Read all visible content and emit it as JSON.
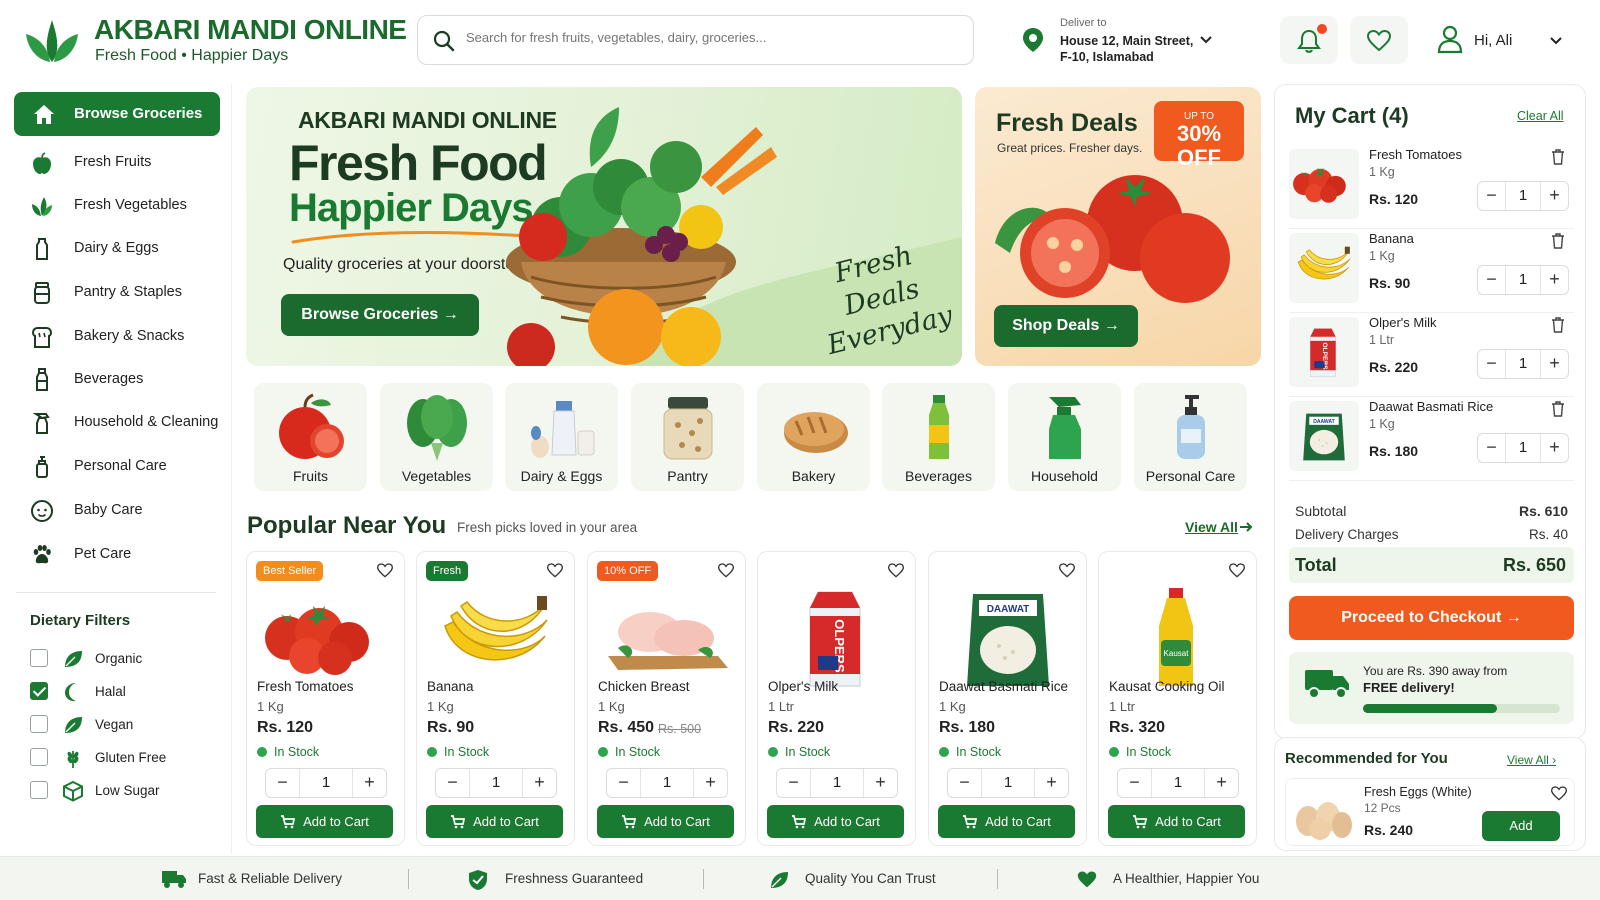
{
  "header": {
    "brand": "AKBARI MANDI ONLINE",
    "tagline": "Fresh Food • Happier Days",
    "search_placeholder": "Search for fresh fruits, vegetables, dairy, groceries...",
    "deliver_label": "Deliver to",
    "deliver_address": "House 12, Main Street, F-10, Islamabad",
    "greeting": "Hi, Ali",
    "icons": [
      "leaf-logo",
      "search",
      "location-pin",
      "chevron-down",
      "bell",
      "heart",
      "user"
    ],
    "notification_dot": true
  },
  "sidebar": {
    "active": {
      "label": "Browse Groceries",
      "icon": "home"
    },
    "items": [
      {
        "label": "Fresh Fruits",
        "icon": "apple"
      },
      {
        "label": "Fresh Vegetables",
        "icon": "leaf"
      },
      {
        "label": "Dairy & Eggs",
        "icon": "bottle"
      },
      {
        "label": "Pantry & Staples",
        "icon": "jar"
      },
      {
        "label": "Bakery & Snacks",
        "icon": "bread"
      },
      {
        "label": "Beverages",
        "icon": "drink-bottle"
      },
      {
        "label": "Household & Cleaning",
        "icon": "spray-bottle"
      },
      {
        "label": "Personal Care",
        "icon": "pump-bottle"
      },
      {
        "label": "Baby Care",
        "icon": "baby-face"
      },
      {
        "label": "Pet Care",
        "icon": "paw"
      }
    ],
    "filters_title": "Dietary Filters",
    "filters": [
      {
        "label": "Organic",
        "checked": false,
        "icon": "leaf"
      },
      {
        "label": "Halal",
        "checked": true,
        "icon": "crescent-moon"
      },
      {
        "label": "Vegan",
        "checked": false,
        "icon": "leaf"
      },
      {
        "label": "Gluten Free",
        "checked": false,
        "icon": "wheat"
      },
      {
        "label": "Low Sugar",
        "checked": false,
        "icon": "cube"
      }
    ]
  },
  "hero": {
    "kicker": "AKBARI MANDI ONLINE",
    "title_line1": "Fresh Food",
    "title_line2": "Happier Days",
    "description": "Quality groceries at your doorstep.",
    "button": "Browse Groceries",
    "script_line1": "Fresh",
    "script_line2": "Deals",
    "script_line3": "Everyday"
  },
  "deals": {
    "title": "Fresh Deals",
    "subtitle": "Great prices. Fresher days.",
    "badge_top": "UP TO",
    "badge_value": "30% OFF",
    "button": "Shop Deals"
  },
  "categories": [
    {
      "label": "Fruits",
      "icon": "apple"
    },
    {
      "label": "Vegetables",
      "icon": "leafy-greens"
    },
    {
      "label": "Dairy & Eggs",
      "icon": "milk-eggs"
    },
    {
      "label": "Pantry",
      "icon": "jar"
    },
    {
      "label": "Bakery",
      "icon": "bread"
    },
    {
      "label": "Beverages",
      "icon": "bottle"
    },
    {
      "label": "Household",
      "icon": "spray-bottle"
    },
    {
      "label": "Personal Care",
      "icon": "pump-bottle"
    }
  ],
  "popular": {
    "title": "Popular Near You",
    "subtitle": "Fresh picks loved in your area",
    "view_all": "View All",
    "add_label": "Add to Cart",
    "products": [
      {
        "name": "Fresh Tomatoes",
        "unit": "1 Kg",
        "price": "Rs. 120",
        "old_price": "",
        "stock": "In Stock",
        "qty": "1",
        "badge": "Best Seller",
        "badge_color": "#f28c1c",
        "image": "tomatoes"
      },
      {
        "name": "Banana",
        "unit": "1 Kg",
        "price": "Rs. 90",
        "old_price": "",
        "stock": "In Stock",
        "qty": "1",
        "badge": "Fresh",
        "badge_color": "#1b7a32",
        "image": "bananas"
      },
      {
        "name": "Chicken Breast",
        "unit": "1 Kg",
        "price": "Rs. 450",
        "old_price": "Rs. 500",
        "stock": "In Stock",
        "qty": "1",
        "badge": "10% OFF",
        "badge_color": "#f05a1e",
        "image": "chicken"
      },
      {
        "name": "Olper's Milk",
        "unit": "1 Ltr",
        "price": "Rs. 220",
        "old_price": "",
        "stock": "In Stock",
        "qty": "1",
        "badge": "",
        "badge_color": "",
        "image": "milk-carton"
      },
      {
        "name": "Daawat Basmati Rice",
        "unit": "1 Kg",
        "price": "Rs. 180",
        "old_price": "",
        "stock": "In Stock",
        "qty": "1",
        "badge": "",
        "badge_color": "",
        "image": "rice-bag"
      },
      {
        "name": "Kausat Cooking Oil",
        "unit": "1 Ltr",
        "price": "Rs. 320",
        "old_price": "",
        "stock": "In Stock",
        "qty": "1",
        "badge": "",
        "badge_color": "",
        "image": "oil-bottle"
      }
    ]
  },
  "cart": {
    "title": "My Cart (4)",
    "clear": "Clear All",
    "items": [
      {
        "name": "Fresh Tomatoes",
        "unit": "1 Kg",
        "price": "Rs. 120",
        "qty": "1",
        "image": "tomatoes"
      },
      {
        "name": "Banana",
        "unit": "1 Kg",
        "price": "Rs. 90",
        "qty": "1",
        "image": "bananas"
      },
      {
        "name": "Olper's Milk",
        "unit": "1 Ltr",
        "price": "Rs. 220",
        "qty": "1",
        "image": "milk-carton"
      },
      {
        "name": "Daawat Basmati Rice",
        "unit": "1 Kg",
        "price": "Rs. 180",
        "qty": "1",
        "image": "rice-bag"
      }
    ],
    "subtotal_label": "Subtotal",
    "subtotal": "Rs. 610",
    "delivery_label": "Delivery Charges",
    "delivery": "Rs. 40",
    "total_label": "Total",
    "total": "Rs. 650",
    "checkout": "Proceed to Checkout",
    "free_line1": "You are Rs. 390 away from",
    "free_line2": "FREE delivery!",
    "free_progress": 0.68
  },
  "recommended": {
    "title": "Recommended for You",
    "view_all": "View All",
    "item": {
      "name": "Fresh Eggs (White)",
      "unit": "12 Pcs",
      "price": "Rs. 240",
      "button": "Add",
      "image": "eggs"
    }
  },
  "footer": [
    {
      "label": "Fast & Reliable Delivery",
      "icon": "truck"
    },
    {
      "label": "Freshness Guaranteed",
      "icon": "shield-check"
    },
    {
      "label": "Quality You Can Trust",
      "icon": "leaf"
    },
    {
      "label": "A Healthier, Happier You",
      "icon": "heart"
    }
  ],
  "colors": {
    "primary": "#1b7a32",
    "dark_green": "#1b6b2e",
    "accent_orange": "#f05a1e",
    "text": "#1d3a22"
  }
}
